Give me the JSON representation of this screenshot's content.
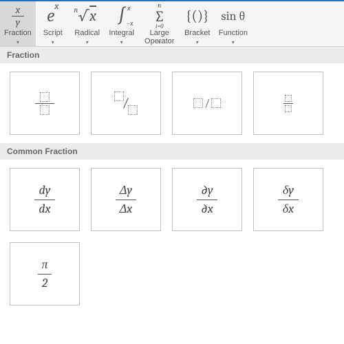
{
  "ribbon": {
    "fraction": {
      "label": "Fraction",
      "icon_top": "x",
      "icon_bottom": "y",
      "active": true,
      "dropdown": true
    },
    "script": {
      "label": "Script",
      "icon_base": "e",
      "icon_exp": "x",
      "dropdown": true
    },
    "radical": {
      "label": "Radical",
      "icon_nth": "n",
      "icon_arg": "x",
      "dropdown": true
    },
    "integral": {
      "label": "Integral",
      "icon_upper": "x",
      "icon_lower": "−x",
      "dropdown": true
    },
    "large_operator": {
      "label": "Large\nOperator",
      "icon_upper": "n",
      "icon_lower": "i=0",
      "dropdown": true
    },
    "bracket": {
      "label": "Bracket",
      "icon": "{()}",
      "dropdown": true
    },
    "function": {
      "label": "Function",
      "icon": "sin θ",
      "dropdown": true
    }
  },
  "sections": {
    "fraction_header": "Fraction",
    "common_header": "Common Fraction"
  },
  "fraction_templates": [
    {
      "name": "stacked-fraction"
    },
    {
      "name": "skewed-fraction"
    },
    {
      "name": "linear-fraction"
    },
    {
      "name": "small-fraction"
    }
  ],
  "common_fractions": [
    {
      "name": "dy-dx",
      "num": "dy",
      "den": "dx"
    },
    {
      "name": "delta-y-delta-x",
      "num": "Δy",
      "den": "Δx"
    },
    {
      "name": "partial-y-partial-x",
      "num": "∂y",
      "den": "∂x"
    },
    {
      "name": "small-delta-y-x",
      "num": "δy",
      "den": "δx"
    },
    {
      "name": "pi-over-2",
      "num": "π",
      "den": "2"
    }
  ]
}
